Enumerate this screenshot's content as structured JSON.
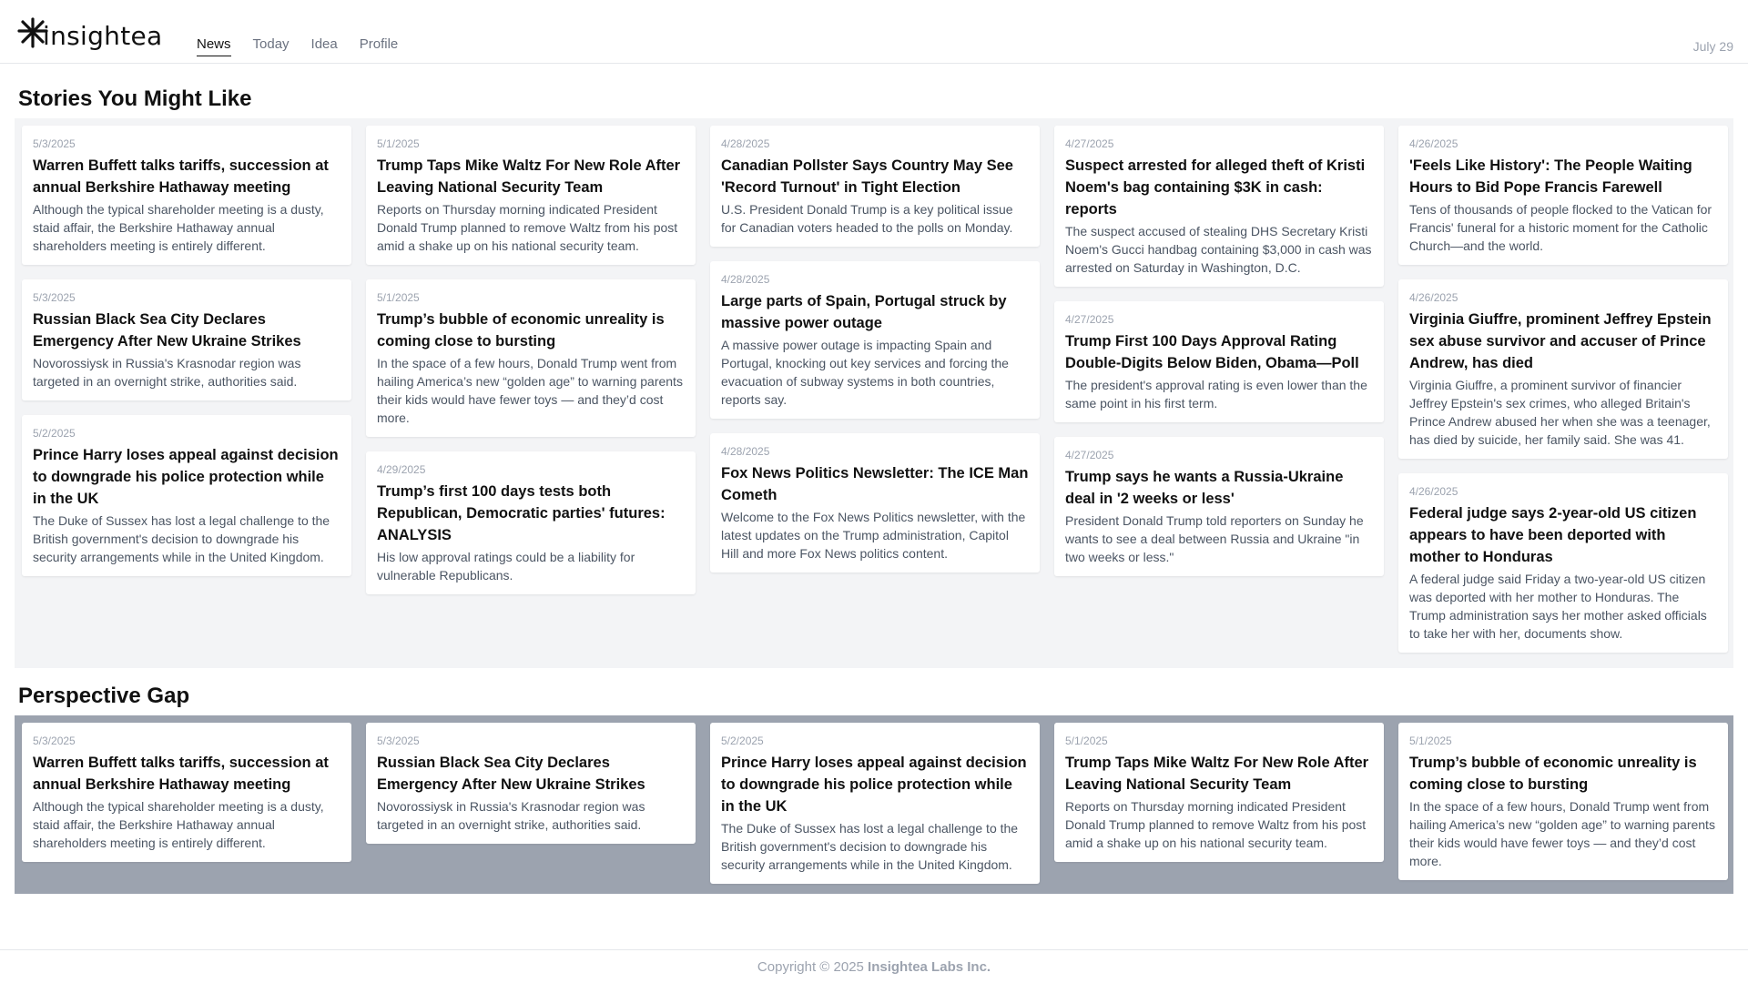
{
  "app": {
    "logo_icon": "asterisk-logo-icon",
    "logo_text": "insightea"
  },
  "nav": {
    "items": [
      {
        "label": "News",
        "active": true
      },
      {
        "label": "Today",
        "active": false
      },
      {
        "label": "Idea",
        "active": false
      },
      {
        "label": "Profile",
        "active": false
      }
    ]
  },
  "header": {
    "date": "July 29"
  },
  "stories": {
    "title": "Stories You Might Like",
    "columns": [
      [
        {
          "date": "5/3/2025",
          "title": "Warren Buffett talks tariffs, succession at annual Berkshire Hathaway meeting",
          "desc": "Although the typical shareholder meeting is a dusty, staid affair, the Berkshire Hathaway annual shareholders meeting is entirely different."
        },
        {
          "date": "5/3/2025",
          "title": "Russian Black Sea City Declares Emergency After New Ukraine Strikes",
          "desc": "Novorossiysk in Russia's Krasnodar region was targeted in an overnight strike, authorities said."
        },
        {
          "date": "5/2/2025",
          "title": "Prince Harry loses appeal against decision to downgrade his police protection while in the UK",
          "desc": "The Duke of Sussex has lost a legal challenge to the British government's decision to downgrade his security arrangements while in the United Kingdom."
        }
      ],
      [
        {
          "date": "5/1/2025",
          "title": "Trump Taps Mike Waltz For New Role After Leaving National Security Team",
          "desc": "Reports on Thursday morning indicated President Donald Trump planned to remove Waltz from his post amid a shake up on his national security team."
        },
        {
          "date": "5/1/2025",
          "title": "Trump’s bubble of economic unreality is coming close to bursting",
          "desc": "In the space of a few hours, Donald Trump went from hailing America’s new “golden age” to warning parents their kids would have fewer toys — and they’d cost more."
        },
        {
          "date": "4/29/2025",
          "title": "Trump’s first 100 days tests both Republican, Democratic parties' futures: ANALYSIS",
          "desc": "His low approval ratings could be a liability for vulnerable Republicans."
        }
      ],
      [
        {
          "date": "4/28/2025",
          "title": "Canadian Pollster Says Country May See 'Record Turnout' in Tight Election",
          "desc": "U.S. President Donald Trump is a key political issue for Canadian voters headed to the polls on Monday."
        },
        {
          "date": "4/28/2025",
          "title": "Large parts of Spain, Portugal struck by massive power outage",
          "desc": "A massive power outage is impacting Spain and Portugal, knocking out key services and forcing the evacuation of subway systems in both countries, reports say."
        },
        {
          "date": "4/28/2025",
          "title": "Fox News Politics Newsletter: The ICE Man Cometh",
          "desc": "Welcome to the Fox News Politics newsletter, with the latest updates on the Trump administration, Capitol Hill and more Fox News politics content."
        }
      ],
      [
        {
          "date": "4/27/2025",
          "title": "Suspect arrested for alleged theft of Kristi Noem's bag containing $3K in cash: reports",
          "desc": "The suspect accused of stealing DHS Secretary Kristi Noem's Gucci handbag containing $3,000 in cash was arrested on Saturday in Washington, D.C."
        },
        {
          "date": "4/27/2025",
          "title": "Trump First 100 Days Approval Rating Double-Digits Below Biden, Obama—Poll",
          "desc": "The president's approval rating is even lower than the same point in his first term."
        },
        {
          "date": "4/27/2025",
          "title": "Trump says he wants a Russia-Ukraine deal in '2 weeks or less'",
          "desc": "President Donald Trump told reporters on Sunday he wants to see a deal between Russia and Ukraine \"in two weeks or less.\""
        }
      ],
      [
        {
          "date": "4/26/2025",
          "title": "'Feels Like History': The People Waiting Hours to Bid Pope Francis Farewell",
          "desc": "Tens of thousands of people flocked to the Vatican for Francis' funeral for a historic moment for the Catholic Church—and the world."
        },
        {
          "date": "4/26/2025",
          "title": "Virginia Giuffre, prominent Jeffrey Epstein sex abuse survivor and accuser of Prince Andrew, has died",
          "desc": "Virginia Giuffre, a prominent survivor of financier Jeffrey Epstein's sex crimes, who alleged Britain's Prince Andrew abused her when she was a teenager, has died by suicide, her family said. She was 41."
        },
        {
          "date": "4/26/2025",
          "title": "Federal judge says 2-year-old US citizen appears to have been deported with mother to Honduras",
          "desc": "A federal judge said Friday a two-year-old US citizen was deported with her mother to Honduras. The Trump administration says her mother asked officials to take her with her, documents show."
        }
      ]
    ]
  },
  "perspective": {
    "title": "Perspective Gap",
    "cards": [
      {
        "date": "5/3/2025",
        "title": "Warren Buffett talks tariffs, succession at annual Berkshire Hathaway meeting",
        "desc": "Although the typical shareholder meeting is a dusty, staid affair, the Berkshire Hathaway annual shareholders meeting is entirely different."
      },
      {
        "date": "5/3/2025",
        "title": "Russian Black Sea City Declares Emergency After New Ukraine Strikes",
        "desc": "Novorossiysk in Russia's Krasnodar region was targeted in an overnight strike, authorities said."
      },
      {
        "date": "5/2/2025",
        "title": "Prince Harry loses appeal against decision to downgrade his police protection while in the UK",
        "desc": "The Duke of Sussex has lost a legal challenge to the British government's decision to downgrade his security arrangements while in the United Kingdom."
      },
      {
        "date": "5/1/2025",
        "title": "Trump Taps Mike Waltz For New Role After Leaving National Security Team",
        "desc": "Reports on Thursday morning indicated President Donald Trump planned to remove Waltz from his post amid a shake up on his national security team."
      },
      {
        "date": "5/1/2025",
        "title": "Trump’s bubble of economic unreality is coming close to bursting",
        "desc": "In the space of a few hours, Donald Trump went from hailing America’s new “golden age” to warning parents their kids would have fewer toys — and they’d cost more."
      }
    ]
  },
  "footer": {
    "copyright": "Copyright © 2025",
    "company": "Insightea Labs Inc."
  },
  "colors": {
    "stories_panel_bg": "#f3f4f6",
    "perspective_panel_bg": "#9ca3af",
    "text_primary": "#111111",
    "text_muted": "#9ca3af"
  }
}
